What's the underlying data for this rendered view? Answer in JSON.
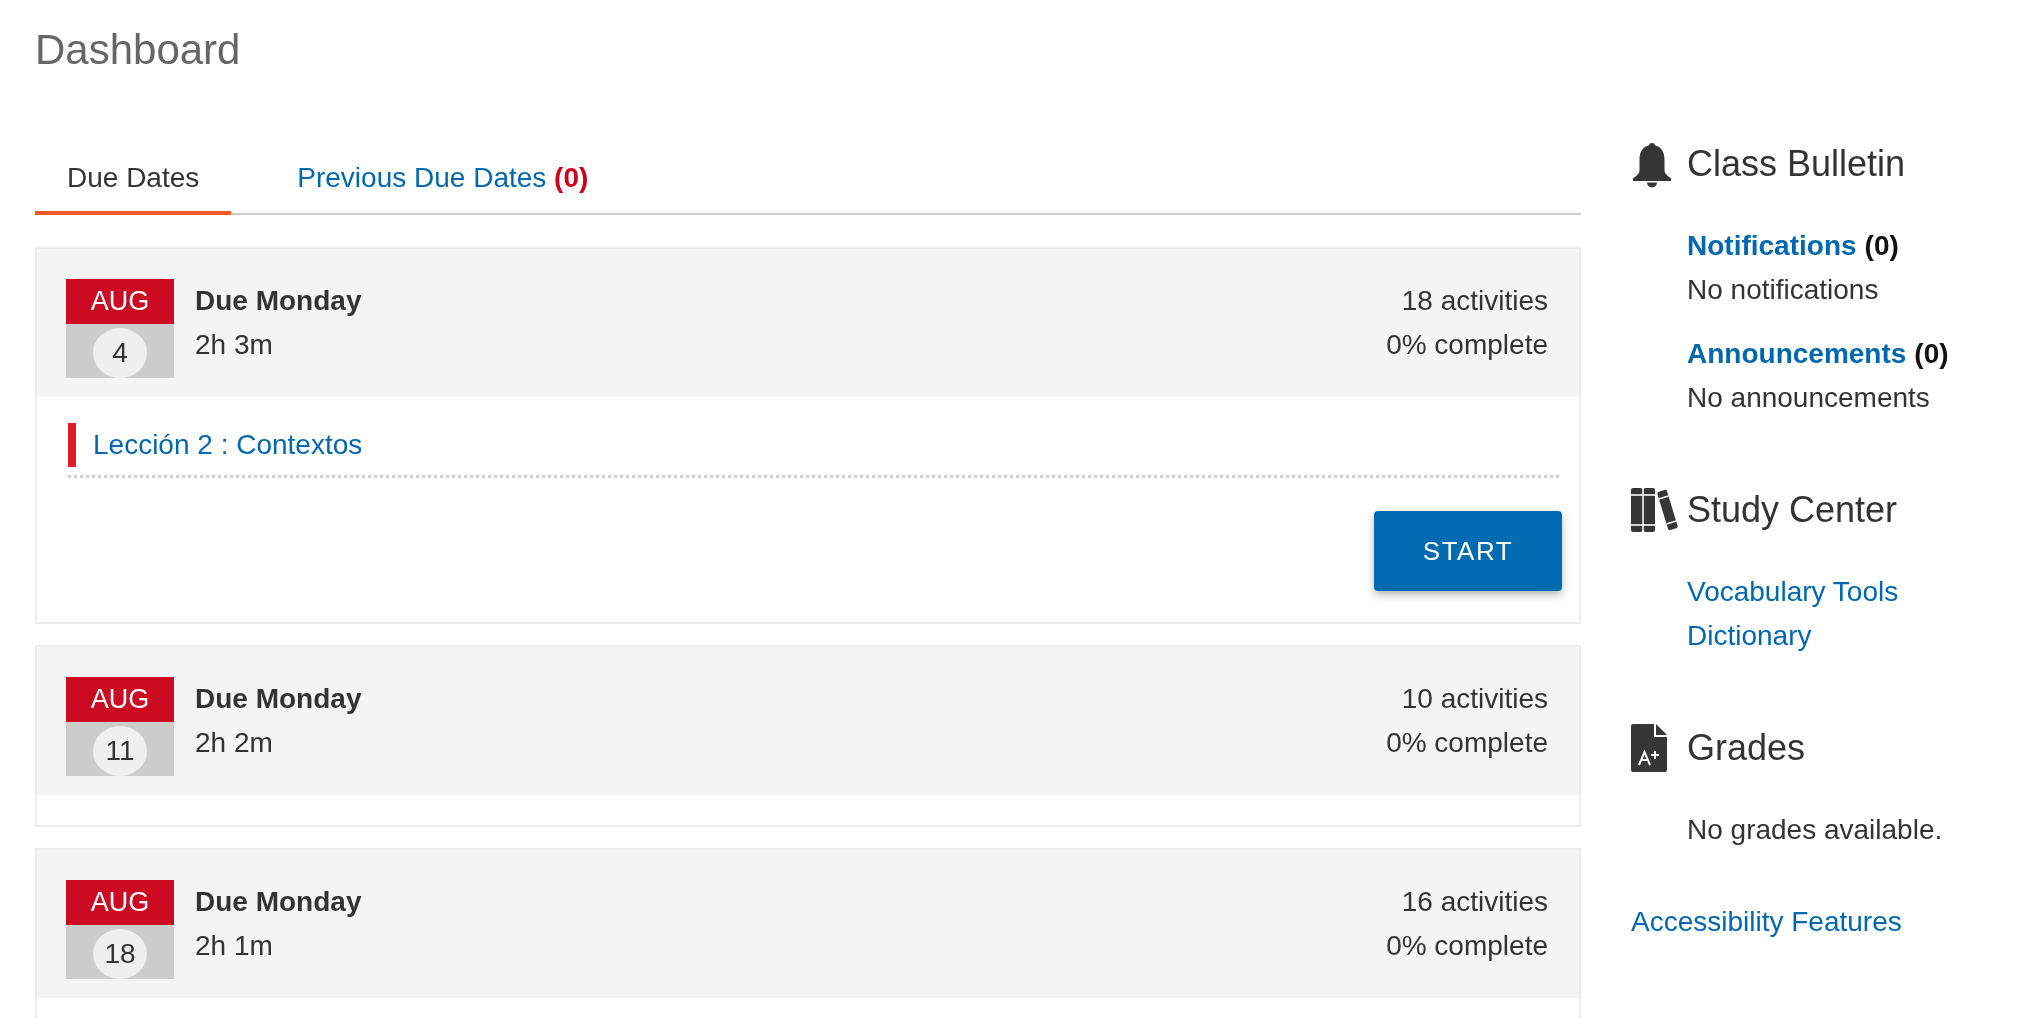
{
  "page": {
    "title": "Dashboard"
  },
  "tabs": [
    {
      "label": "Due Dates",
      "selected": true
    },
    {
      "label": "Previous Due Dates",
      "count": "(0)",
      "selected": false
    }
  ],
  "due_dates": [
    {
      "month": "AUG",
      "day": "4",
      "title": "Due Monday",
      "time_left": "2h 3m",
      "activities": "18 activities",
      "progress": "0% complete",
      "assignments": [
        {
          "title": "Lección 2 : Contextos"
        }
      ],
      "action": "START"
    },
    {
      "month": "AUG",
      "day": "11",
      "title": "Due Monday",
      "time_left": "2h 2m",
      "activities": "10 activities",
      "progress": "0% complete"
    },
    {
      "month": "AUG",
      "day": "18",
      "title": "Due Monday",
      "time_left": "2h 1m",
      "activities": "16 activities",
      "progress": "0% complete"
    }
  ],
  "sidebar": {
    "sections": [
      {
        "kind": "bulletin",
        "title": "Class Bulletin",
        "items": [
          {
            "label": "Notifications",
            "count": "(0)",
            "note": "No notifications"
          },
          {
            "label": "Announcements",
            "count": "(0)",
            "note": "No announcements"
          }
        ]
      },
      {
        "kind": "study",
        "title": "Study Center",
        "links": [
          "Vocabulary Tools",
          "Dictionary"
        ]
      },
      {
        "kind": "grades",
        "title": "Grades",
        "note": "No grades available."
      }
    ],
    "footer_link": "Accessibility Features"
  }
}
